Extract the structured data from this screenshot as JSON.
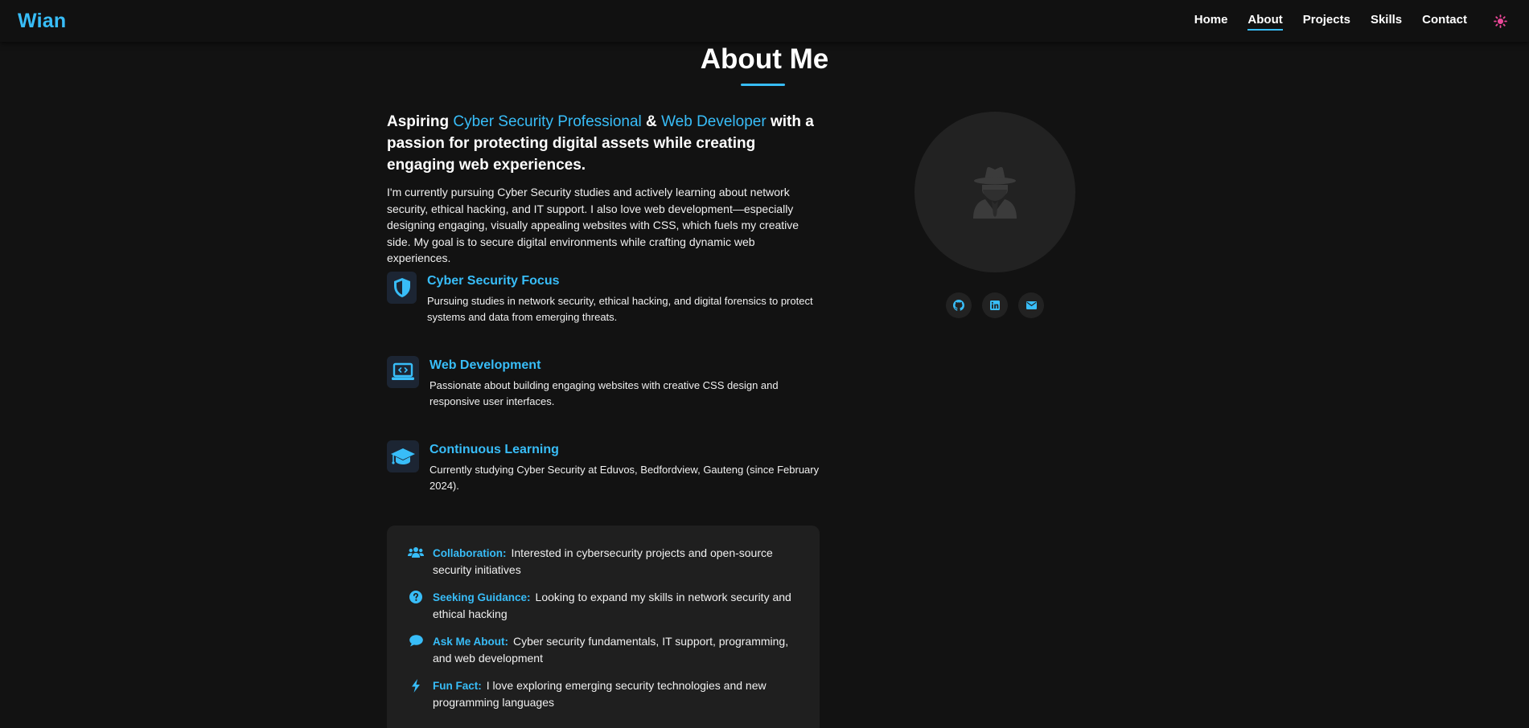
{
  "nav": {
    "logo": "Wian",
    "links": [
      {
        "label": "Home",
        "active": false
      },
      {
        "label": "About",
        "active": true
      },
      {
        "label": "Projects",
        "active": false
      },
      {
        "label": "Skills",
        "active": false
      },
      {
        "label": "Contact",
        "active": false
      }
    ],
    "theme_icon": "sun-icon",
    "theme_color": "#ec4899"
  },
  "about": {
    "title": "About Me",
    "headline": {
      "part1": "Aspiring ",
      "highlight1": "Cyber Security Professional",
      "part2": " & ",
      "highlight2": "Web Developer",
      "part3": " with a passion for protecting digital assets while creating engaging web experiences."
    },
    "intro": "I'm currently pursuing Cyber Security studies and actively learning about network security, ethical hacking, and IT support. I also love web development—especially designing engaging, visually appealing websites with CSS, which fuels my creative side. My goal is to secure digital environments while crafting dynamic web experiences.",
    "features": [
      {
        "icon": "shield-icon",
        "title": "Cyber Security Focus",
        "desc": "Pursuing studies in network security, ethical hacking, and digital forensics to protect systems and data from emerging threats."
      },
      {
        "icon": "laptop-code-icon",
        "title": "Web Development",
        "desc": "Passionate about building engaging websites with creative CSS design and responsive user interfaces."
      },
      {
        "icon": "graduation-cap-icon",
        "title": "Continuous Learning",
        "desc": "Currently studying Cyber Security at Eduvos, Bedfordview, Gauteng (since February 2024)."
      }
    ],
    "info": [
      {
        "icon": "users-icon",
        "label": "Collaboration:",
        "text": "Interested in cybersecurity projects and open-source security initiatives"
      },
      {
        "icon": "question-circle-icon",
        "label": "Seeking Guidance:",
        "text": "Looking to expand my skills in network security and ethical hacking"
      },
      {
        "icon": "comment-icon",
        "label": "Ask Me About:",
        "text": "Cyber security fundamentals, IT support, programming, and web development"
      },
      {
        "icon": "bolt-icon",
        "label": "Fun Fact:",
        "text": "I love exploring emerging security technologies and new programming languages"
      }
    ],
    "avatar_icon": "user-secret-icon",
    "socials": [
      {
        "icon": "github-icon"
      },
      {
        "icon": "linkedin-icon"
      },
      {
        "icon": "envelope-icon"
      }
    ]
  },
  "colors": {
    "accent": "#38bdf8",
    "background": "#121212",
    "card": "#1f1f1f"
  }
}
